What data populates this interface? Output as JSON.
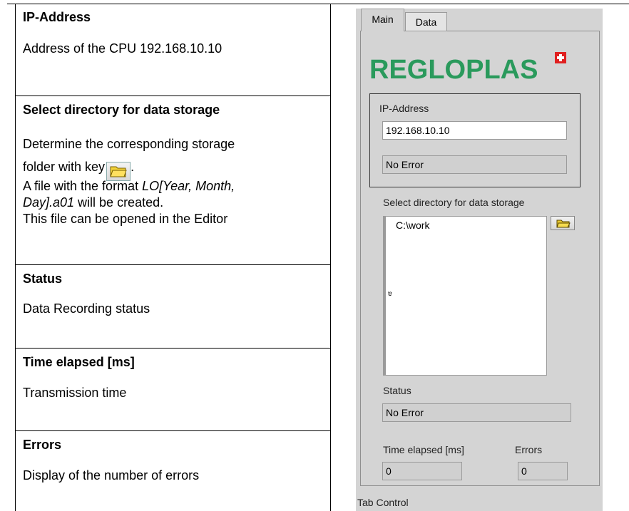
{
  "document": {
    "rows": [
      {
        "heading": "IP-Address",
        "body": [
          "Address of the CPU 192.168.10.10"
        ]
      },
      {
        "heading": "Select directory for data storage",
        "body_line1": "Determine the corresponding storage",
        "body_line2": "folder with key",
        "body_line2_end": ".",
        "body_line3_prefix": "A file with the format ",
        "body_line3_italic": "LO[Year, Month,",
        "body_line4_italic": "Day].a01",
        "body_line4_suffix": " will be created.",
        "body_line5": "This file can be opened in the Editor"
      },
      {
        "heading": "Status",
        "body": [
          "Data Recording status"
        ]
      },
      {
        "heading": "Time elapsed [ms]",
        "body": [
          "Transmission time"
        ]
      },
      {
        "heading": "Errors",
        "body": [
          "Display of the number of errors"
        ]
      }
    ],
    "folder_key_icon": "open-folder-icon"
  },
  "panel": {
    "tabs": [
      {
        "label": "Main"
      },
      {
        "label": "Data"
      }
    ],
    "logo_text": "REGLOPLAS",
    "logo_color": "#2a9a5c",
    "ip_label": "IP-Address",
    "ip_value": "192.168.10.10",
    "ip_error": "No Error",
    "dir_label": "Select directory for data storage",
    "dir_value": "C:\\work",
    "dir_mark": "ɐ",
    "status_label": "Status",
    "status_value": "No Error",
    "time_label": "Time elapsed [ms]",
    "time_value": "0",
    "errors_label": "Errors",
    "errors_value": "0",
    "caption": "Tab Control"
  }
}
